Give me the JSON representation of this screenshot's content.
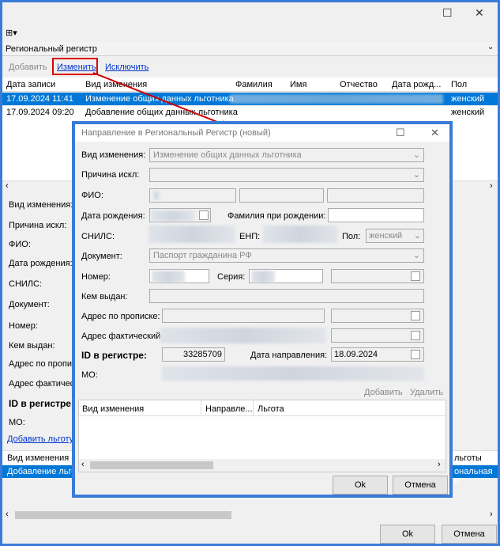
{
  "main": {
    "title_icon": "grid-dropdown-icon",
    "group_label": "Региональный регистр",
    "toolbar": {
      "add": "Добавить",
      "edit": "Изменить",
      "exclude": "Исключить"
    },
    "columns": [
      "Дата записи",
      "Вид изменения",
      "Фамилия",
      "Имя",
      "Отчество",
      "Дата рожд...",
      "Пол"
    ],
    "rows": [
      {
        "date": "17.09.2024 11:41",
        "change": "Изменение общих данных льготника",
        "sex": "женский"
      },
      {
        "date": "17.09.2024 09:20",
        "change": "Добавление общих данных льготника",
        "sex": "женский"
      }
    ],
    "form_labels": [
      "Вид изменения:",
      "Причина искл:",
      "ФИО:",
      "Дата рождения:",
      "СНИЛС:",
      "Документ:",
      "Номер:",
      "Кем выдан:",
      "Адрес по прописк",
      "Адрес фактическ",
      "ID в регистре:",
      "МО:"
    ],
    "add_benefit_link": "Добавить льготу",
    "bottom_columns": [
      "Вид изменения",
      "льготы"
    ],
    "bottom_row": [
      "Добавление льго",
      "ональная п"
    ],
    "ok": "Ok",
    "cancel": "Отмена"
  },
  "dialog": {
    "title": "Направление в Региональный Регистр (новый)",
    "labels": {
      "change_type": "Вид изменения:",
      "exclusion_reason": "Причина искл:",
      "fio": "ФИО:",
      "birth_date": "Дата рождения:",
      "birth_surname": "Фамилия при рождении:",
      "snils": "СНИЛС:",
      "enp": "ЕНП:",
      "sex": "Пол:",
      "document": "Документ:",
      "number": "Номер:",
      "series": "Серия:",
      "issued_by": "Кем выдан:",
      "reg_address": "Адрес по прописке:",
      "actual_address": "Адрес фактический",
      "registry_id": "ID в регистре:",
      "direction_date": "Дата направления:",
      "mo": "МО:"
    },
    "values": {
      "change_type": "Изменение общих данных льготника",
      "sex": "женский",
      "document": "Паспорт гражданина РФ",
      "registry_id": "33285709",
      "direction_date": "18.09.2024"
    },
    "grid_actions": {
      "add": "Добавить",
      "delete": "Удалить"
    },
    "grid_columns": [
      "Вид изменения",
      "Направле...",
      "Льгота"
    ],
    "ok": "Ok",
    "cancel": "Отмена",
    "accent": "#3a7bd8",
    "arrow_color": "#cc0000"
  }
}
